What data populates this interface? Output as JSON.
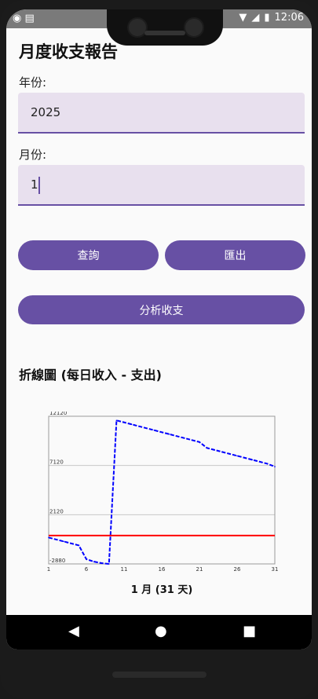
{
  "status_bar": {
    "time": "12:06"
  },
  "page": {
    "title": "月度收支報告",
    "year_label": "年份:",
    "year_value": "2025",
    "month_label": "月份:",
    "month_value": "1"
  },
  "buttons": {
    "query": "查詢",
    "export": "匯出",
    "analyze": "分析收支"
  },
  "chart_section_title": "折線圖 (每日收入 - 支出)",
  "chart_data": {
    "type": "line",
    "xlabel": "1 月 (31 天)",
    "xlim": [
      1,
      31
    ],
    "ylim": [
      -2880,
      12120
    ],
    "x_ticks": [
      1,
      6,
      11,
      16,
      21,
      26,
      31
    ],
    "y_ticks": [
      -2880,
      2120,
      7120,
      12120
    ],
    "grid": true,
    "series": [
      {
        "color": "#0000ff",
        "x": [
          1,
          2,
          3,
          4,
          5,
          6,
          7,
          8,
          9,
          10,
          11,
          12,
          13,
          14,
          15,
          16,
          17,
          18,
          19,
          20,
          21,
          22,
          23,
          24,
          25,
          26,
          27,
          28,
          29,
          30,
          31
        ],
        "y": [
          -200,
          -400,
          -600,
          -800,
          -1000,
          -2400,
          -2650,
          -2800,
          -2880,
          11700,
          11500,
          11300,
          11100,
          10900,
          10700,
          10500,
          10300,
          10100,
          9900,
          9700,
          9500,
          8900,
          8700,
          8500,
          8300,
          8100,
          7900,
          7700,
          7500,
          7300,
          7000
        ]
      },
      {
        "color": "#ff0000",
        "x": [
          1,
          31
        ],
        "y": [
          0,
          0
        ]
      }
    ]
  }
}
